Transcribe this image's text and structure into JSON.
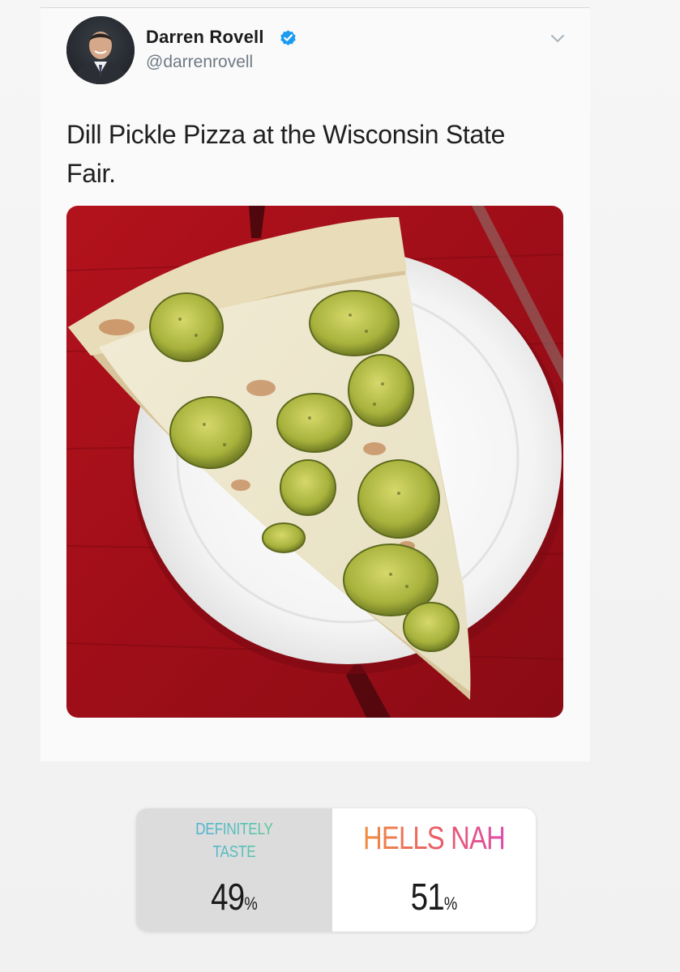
{
  "tweet": {
    "author": {
      "display_name": "Darren Rovell",
      "handle": "@darrenrovell",
      "verified": true
    },
    "text": "Dill Pickle Pizza at the Wisconsin State Fair.",
    "media": {
      "kind": "photo"
    }
  },
  "poll": {
    "options": [
      {
        "label": "DEFINITELY TASTE",
        "percent": "49",
        "percent_sign": "%",
        "colors": [
          "#4aa5e8",
          "#72d06a"
        ]
      },
      {
        "label": "HELLS NAH",
        "percent": "51",
        "percent_sign": "%",
        "colors": [
          "#f0973c",
          "#d94cb8"
        ]
      }
    ]
  },
  "icons": {
    "verified": "verified-badge-icon",
    "menu": "chevron-down-icon"
  },
  "colors": {
    "verified_blue": "#1d9bf0",
    "name_text": "#1c1c1c",
    "handle_text": "#6e7a85"
  }
}
